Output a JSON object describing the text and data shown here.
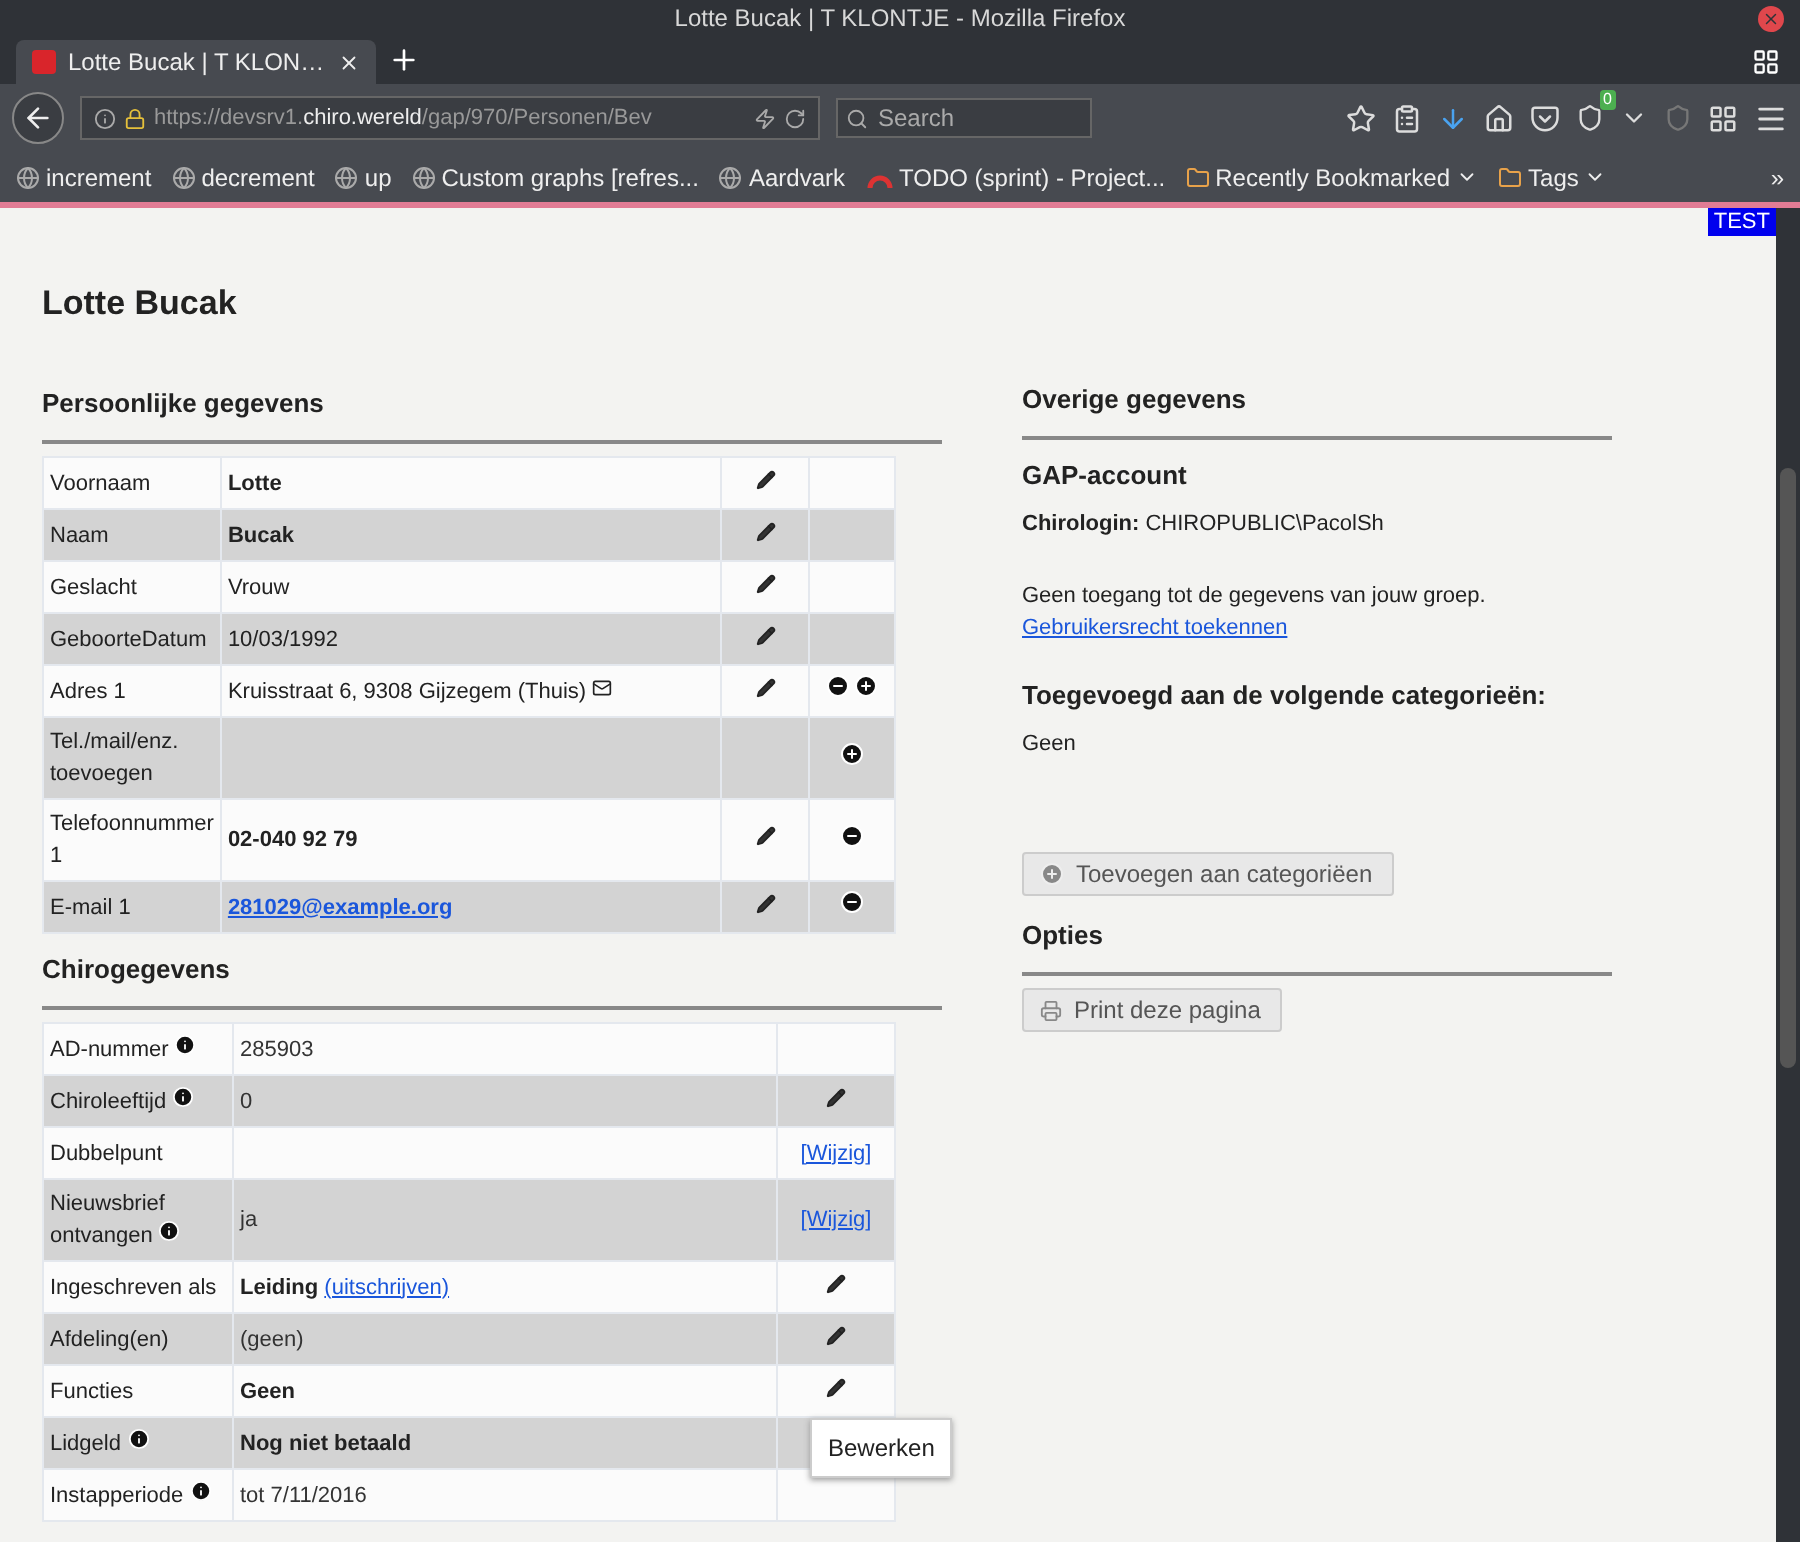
{
  "window": {
    "title": "Lotte Bucak | T KLONTJE - Mozilla Firefox"
  },
  "tabs": [
    {
      "label": "Lotte Bucak | T KLON…",
      "selected": true
    }
  ],
  "address_bar": {
    "url_start": "https://devsrv1.",
    "url_domain": "chiro.wereld",
    "url_path": "/gap/970/Personen/Bev"
  },
  "search": {
    "placeholder": "Search"
  },
  "toolbar_badge": "0",
  "bookmarks": [
    {
      "label": "increment",
      "kind": "globe",
      "dropdown": false
    },
    {
      "label": "decrement",
      "kind": "globe",
      "dropdown": false
    },
    {
      "label": "up",
      "kind": "globe",
      "dropdown": false
    },
    {
      "label": "Custom graphs [refres...",
      "kind": "globe",
      "dropdown": false
    },
    {
      "label": "Aardvark",
      "kind": "globe",
      "dropdown": false
    },
    {
      "label": "TODO (sprint) - Project...",
      "kind": "arc",
      "dropdown": false
    },
    {
      "label": "Recently Bookmarked",
      "kind": "folder",
      "dropdown": true
    },
    {
      "label": "Tags",
      "kind": "folder",
      "dropdown": true
    }
  ],
  "bookmarks_overflow": "»",
  "test_badge": "TEST",
  "page": {
    "title": "Lotte Bucak",
    "personal": {
      "heading": "Persoonlijke gegevens",
      "rows": [
        {
          "kind": "bold",
          "label": "Voornaam",
          "value": "Lotte",
          "edit": true,
          "actions": []
        },
        {
          "kind": "bold",
          "label": "Naam",
          "value": "Bucak",
          "edit": true,
          "actions": []
        },
        {
          "kind": "plain",
          "label": "Geslacht",
          "value": "Vrouw",
          "edit": true,
          "actions": []
        },
        {
          "kind": "plain",
          "label": "GeboorteDatum",
          "value": "10/03/1992",
          "edit": true,
          "actions": []
        },
        {
          "kind": "address",
          "label": "Adres 1",
          "value": "Kruisstraat 6, 9308 Gijzegem (Thuis)",
          "edit": true,
          "actions": [
            {
              "kind": "remove"
            },
            {
              "kind": "add"
            }
          ]
        },
        {
          "kind": "empty",
          "label": "Tel./mail/enz. toevoegen",
          "edit": false,
          "actions": [
            {
              "kind": "add"
            }
          ]
        },
        {
          "kind": "bold",
          "label": "Telefoonnummer 1",
          "value": "02-040 92 79",
          "edit": true,
          "actions": [
            {
              "kind": "remove"
            }
          ]
        },
        {
          "kind": "link",
          "label": "E-mail 1",
          "value": "281029@example.org",
          "edit": true,
          "actions": [
            {
              "kind": "remove"
            }
          ]
        }
      ]
    },
    "chiro": {
      "heading": "Chirogegevens",
      "rows": [
        {
          "kind": "none",
          "label": "AD-nummer",
          "info": true,
          "value": "285903",
          "bold": false
        },
        {
          "kind": "edit",
          "label": "Chiroleeftijd",
          "info": true,
          "value": "0",
          "bold": false
        },
        {
          "kind": "link",
          "label": "Dubbelpunt",
          "info": false,
          "action_text": "[Wijzig]"
        },
        {
          "kind": "link",
          "label": "Nieuwsbrief ontvangen",
          "info": true,
          "value": "ja",
          "bold": false,
          "action_text": "[Wijzig]"
        },
        {
          "kind": "edit",
          "label": "Ingeschreven als",
          "info": false,
          "value": "Leiding",
          "bold": true,
          "link": "(uitschrijven)"
        },
        {
          "kind": "edit",
          "label": "Afdeling(en)",
          "info": false,
          "value": "(geen)",
          "bold": false
        },
        {
          "kind": "edit",
          "label": "Functies",
          "info": false,
          "value": "Geen",
          "bold": true,
          "tooltip": "Bewerken"
        },
        {
          "kind": "none",
          "label": "Lidgeld",
          "info": true,
          "value": "Nog niet betaald",
          "bold": true
        },
        {
          "kind": "none",
          "label": "Instapperiode",
          "info": true,
          "value": "tot 7/11/2016",
          "bold": false
        }
      ]
    },
    "other": {
      "heading": "Overige gegevens",
      "account_heading": "GAP-account",
      "login_label": "Chirologin:",
      "login_value": "CHIROPUBLIC\\PacolSh",
      "access_text": "Geen toegang tot de gegevens van jouw groep.",
      "access_link": "Gebruikersrecht toekennen",
      "categories_heading": "Toegevoegd aan de volgende categorieën:",
      "categories_value": "Geen",
      "add_button": "Toevoegen aan categoriëen"
    },
    "options": {
      "heading": "Opties",
      "print_button": "Print deze pagina"
    }
  }
}
